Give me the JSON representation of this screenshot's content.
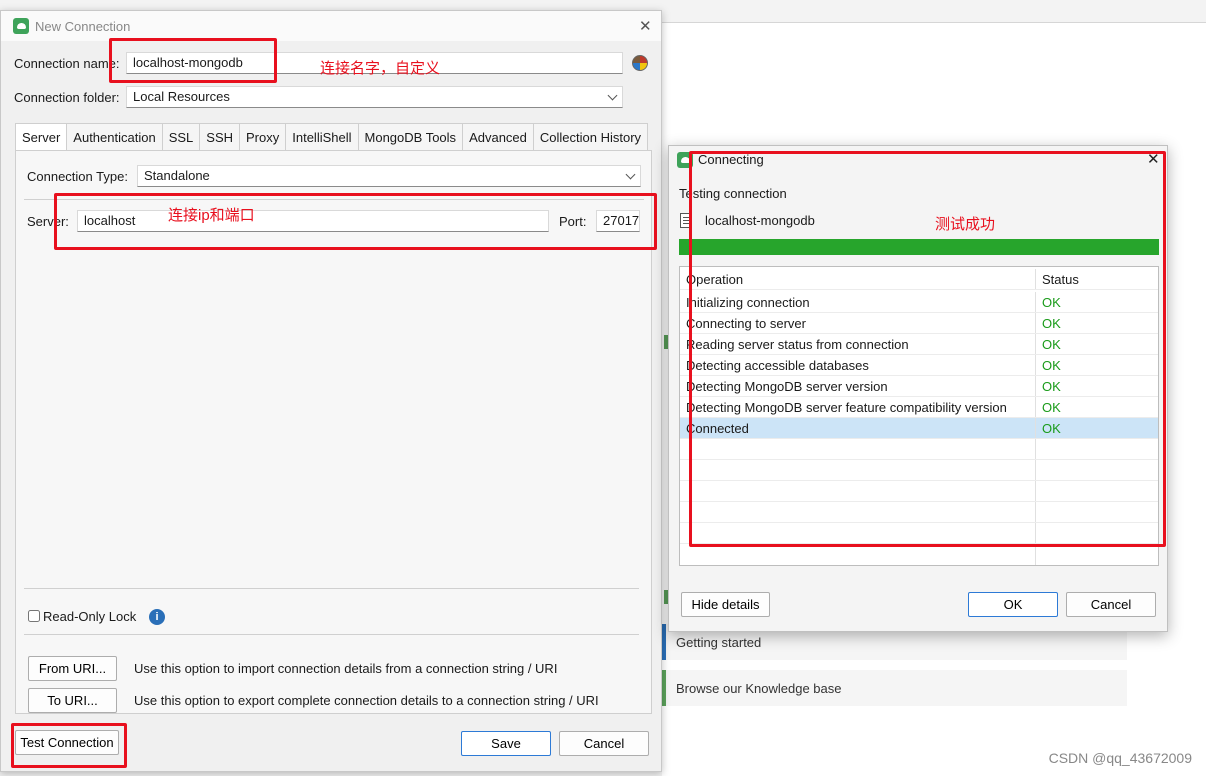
{
  "new_connection": {
    "title": "New Connection",
    "close_glyph": "✕",
    "connection_name_label": "Connection name:",
    "connection_name_value": "localhost-mongodb",
    "connection_folder_label": "Connection folder:",
    "connection_folder_value": "Local Resources",
    "tabs": [
      "Server",
      "Authentication",
      "SSL",
      "SSH",
      "Proxy",
      "IntelliShell",
      "MongoDB Tools",
      "Advanced",
      "Collection History"
    ],
    "connection_type_label": "Connection Type:",
    "connection_type_value": "Standalone",
    "server_label": "Server:",
    "server_value": "localhost",
    "port_label": "Port:",
    "port_value": "27017",
    "read_only_label": "Read-Only Lock",
    "info_glyph": "i",
    "from_uri_button": "From URI...",
    "from_uri_desc": "Use this option to import connection details from a connection string / URI",
    "to_uri_button": "To URI...",
    "to_uri_desc": "Use this option to export complete connection details to a connection string / URI",
    "test_connection_button": "Test Connection",
    "save_button": "Save",
    "cancel_button": "Cancel"
  },
  "connecting": {
    "title": "Connecting",
    "close_glyph": "✕",
    "testing_label": "Testing connection",
    "connection_name": "localhost-mongodb",
    "progress": 1.0,
    "columns": [
      "Operation",
      "Status"
    ],
    "rows": [
      {
        "operation": "Initializing connection",
        "status": "OK"
      },
      {
        "operation": "Connecting to server",
        "status": "OK"
      },
      {
        "operation": "Reading server status from connection",
        "status": "OK"
      },
      {
        "operation": "Detecting accessible databases",
        "status": "OK"
      },
      {
        "operation": "Detecting MongoDB server version",
        "status": "OK"
      },
      {
        "operation": "Detecting MongoDB server feature compatibility version",
        "status": "OK"
      },
      {
        "operation": "Connected",
        "status": "OK"
      }
    ],
    "hide_details_button": "Hide details",
    "ok_button": "OK",
    "cancel_button": "Cancel"
  },
  "annotations": {
    "name_note": "连接名字，自定义",
    "ip_note": "连接ip和端口",
    "success_note": "测试成功"
  },
  "background": {
    "getting_started": "Getting started",
    "knowledge_base": "Browse our Knowledge base"
  },
  "watermark": "CSDN @qq_43672009",
  "colors": {
    "annotation": "#e8101e",
    "progress": "#27a52c",
    "ok_status": "#1a9b1a",
    "primary_border": "#2d7ad6"
  }
}
